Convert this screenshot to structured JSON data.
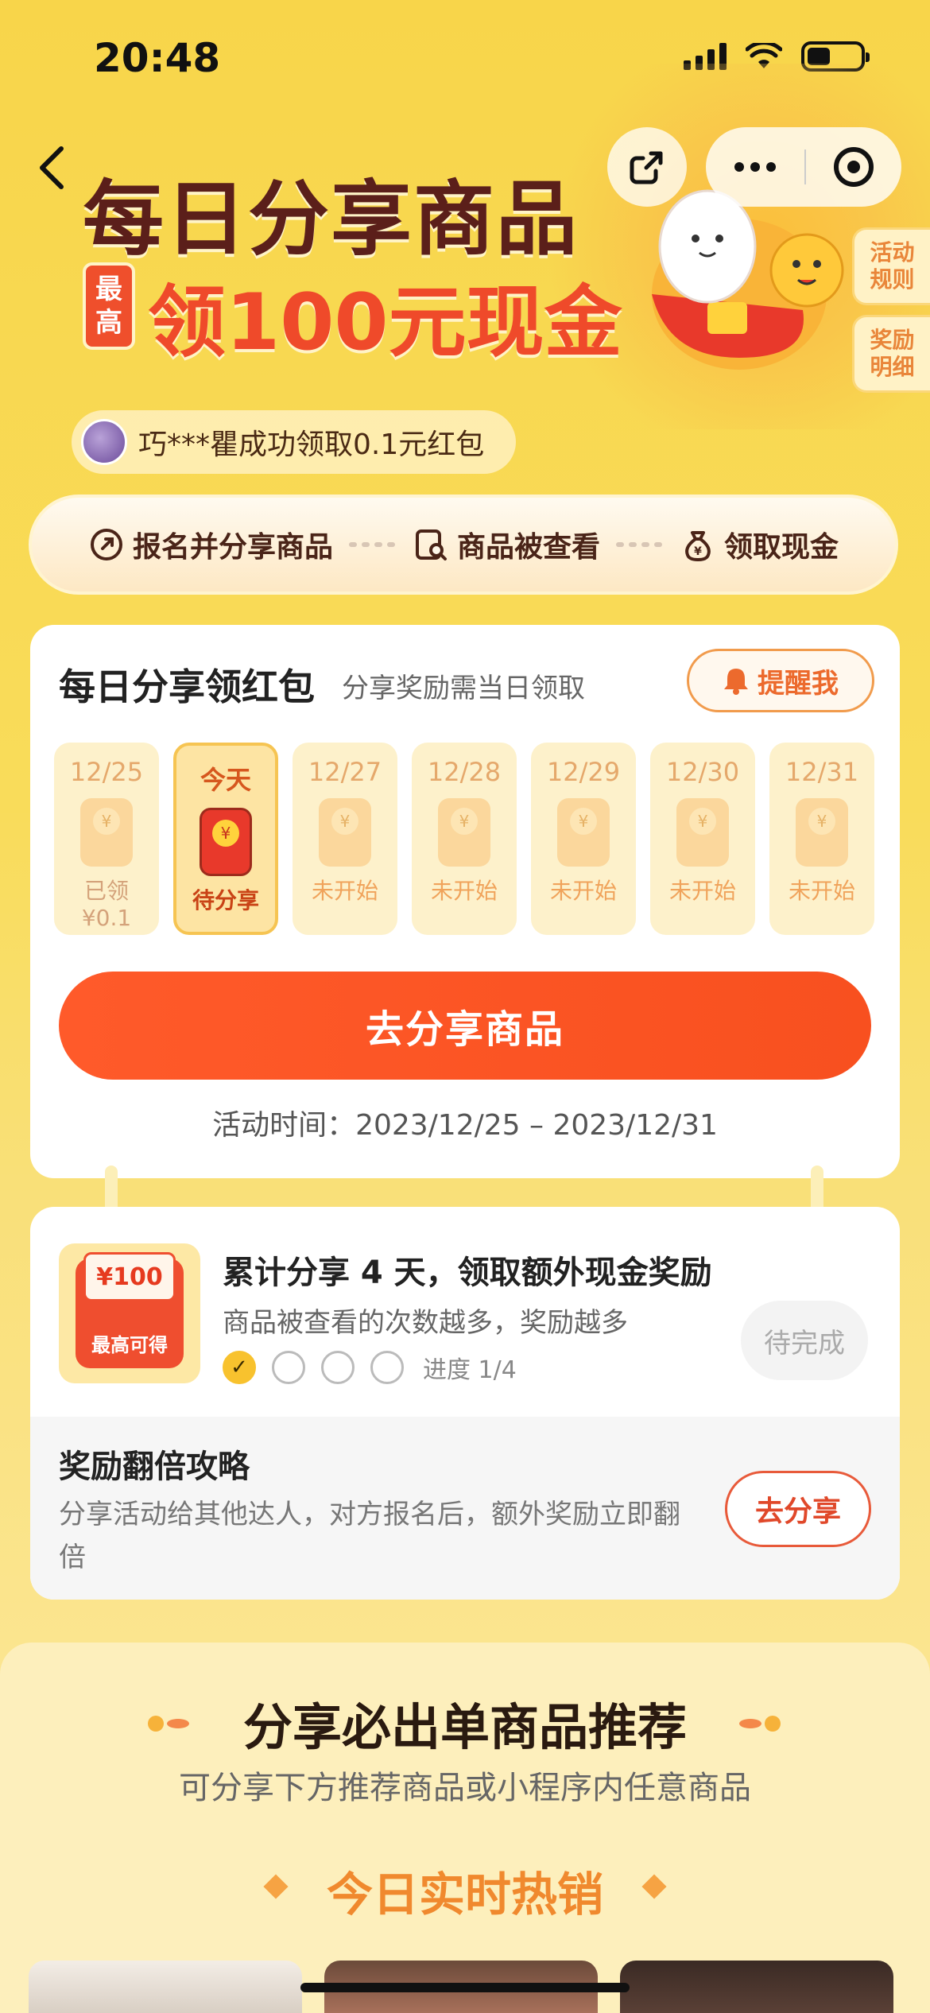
{
  "status_bar": {
    "time": "20:48"
  },
  "hero": {
    "title": "每日分享商品",
    "badge_top": "最",
    "badge_bottom": "高",
    "subtitle": "领100元现金"
  },
  "side_tabs": [
    {
      "line1": "活动",
      "line2": "规则"
    },
    {
      "line1": "奖励",
      "line2": "明细"
    }
  ],
  "ticker": {
    "text": "巧***瞿成功领取0.1元红包"
  },
  "steps": [
    {
      "label": "报名并分享商品",
      "icon": "share-icon"
    },
    {
      "label": "商品被查看",
      "icon": "view-icon"
    },
    {
      "label": "领取现金",
      "icon": "money-bag-icon"
    }
  ],
  "daily": {
    "title": "每日分享领红包",
    "subtitle": "分享奖励需当日领取",
    "remind_label": "提醒我",
    "days": [
      {
        "date": "12/25",
        "status": "已领",
        "amount": "¥0.1",
        "state": "claimed"
      },
      {
        "date": "今天",
        "status": "待分享",
        "amount": "",
        "state": "active"
      },
      {
        "date": "12/27",
        "status": "未开始",
        "amount": "",
        "state": "future"
      },
      {
        "date": "12/28",
        "status": "未开始",
        "amount": "",
        "state": "future"
      },
      {
        "date": "12/29",
        "status": "未开始",
        "amount": "",
        "state": "future"
      },
      {
        "date": "12/30",
        "status": "未开始",
        "amount": "",
        "state": "future"
      },
      {
        "date": "12/31",
        "status": "未开始",
        "amount": "",
        "state": "future"
      }
    ],
    "coin_symbol": "¥",
    "main_button": "去分享商品",
    "period": "活动时间：2023/12/25 – 2023/12/31"
  },
  "cumulative": {
    "reward_amount": "¥100",
    "reward_caption": "最高可得",
    "title": "累计分享 4 天，领取额外现金奖励",
    "subtitle": "商品被查看的次数越多，奖励越多",
    "progress_done": 1,
    "progress_total": 4,
    "progress_label": "进度 1/4",
    "check_mark": "✓",
    "pending_button": "待完成"
  },
  "tips": {
    "title": "奖励翻倍攻略",
    "text": "分享活动给其他达人，对方报名后，额外奖励立即翻倍",
    "button": "去分享"
  },
  "recommend": {
    "title": "分享必出单商品推荐",
    "subtitle": "可分享下方推荐商品或小程序内任意商品",
    "hot_title": "今日实时热销"
  },
  "colors": {
    "accent": "#f8501f",
    "background": "#f9d84e",
    "title_brown": "#5b1f1a"
  }
}
